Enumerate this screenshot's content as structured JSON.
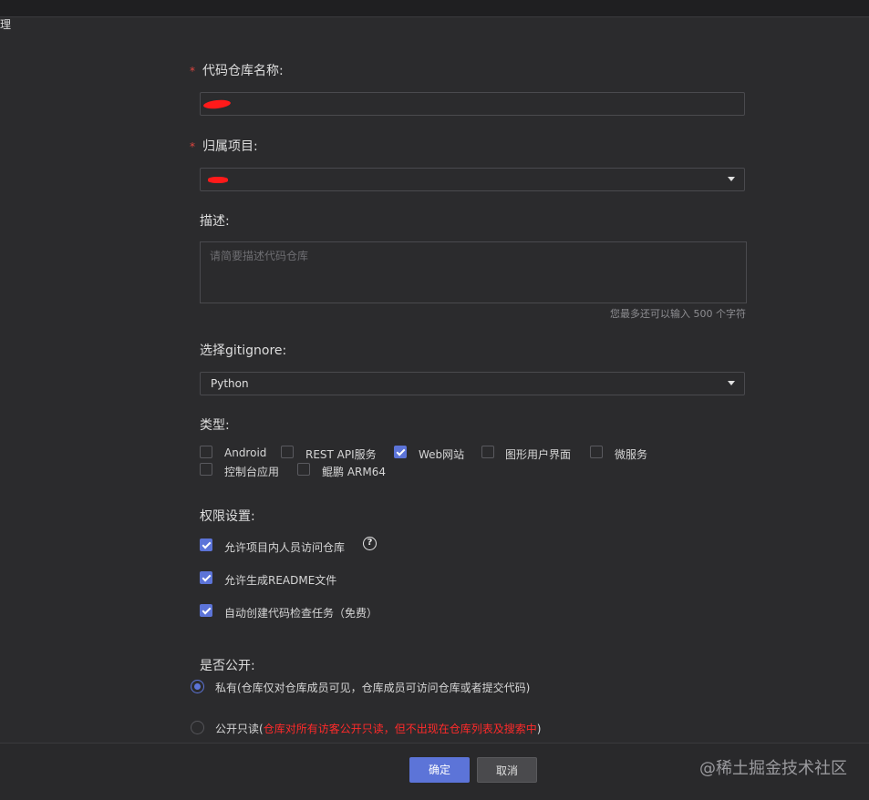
{
  "edge_text": "理",
  "form": {
    "repo_name": {
      "required_mark": "*",
      "label": "代码仓库名称:",
      "value": ""
    },
    "project": {
      "required_mark": "*",
      "label": "归属项目:",
      "value": ""
    },
    "description": {
      "label": "描述:",
      "placeholder": "请简要描述代码仓库",
      "counter": "您最多还可以输入 500 个字符"
    },
    "gitignore": {
      "label": "选择gitignore:",
      "value": "Python"
    },
    "type": {
      "label": "类型:",
      "options": [
        {
          "label": "Android",
          "checked": false
        },
        {
          "label": "REST API服务",
          "checked": false
        },
        {
          "label": "Web网站",
          "checked": true
        },
        {
          "label": "图形用户界面",
          "checked": false
        },
        {
          "label": "微服务",
          "checked": false
        },
        {
          "label": "控制台应用",
          "checked": false
        },
        {
          "label": "鲲鹏 ARM64",
          "checked": false
        }
      ]
    },
    "permissions": {
      "label": "权限设置:",
      "options": [
        {
          "label": "允许项目内人员访问仓库",
          "checked": true
        },
        {
          "label": "允许生成README文件",
          "checked": true
        },
        {
          "label": "自动创建代码检查任务（免费）",
          "checked": true
        }
      ],
      "help_icon": "question-circle-icon"
    },
    "visibility": {
      "label": "是否公开:",
      "private": {
        "label": "私有(仓库仅对仓库成员可见，仓库成员可访问仓库或者提交代码)",
        "selected": true
      },
      "public": {
        "label_prefix": "公开只读(",
        "label_red": "仓库对所有访客公开只读，但不出现在仓库列表及搜索中",
        "label_suffix": ")",
        "selected": false
      }
    }
  },
  "footer": {
    "ok_label": "确定",
    "cancel_label": "取消",
    "watermark": "@稀土掘金技术社区"
  },
  "colors": {
    "accent": "#5c74d8",
    "required": "#e0453f",
    "warning_text": "#ff2a2a",
    "background": "#2b2b2d"
  }
}
